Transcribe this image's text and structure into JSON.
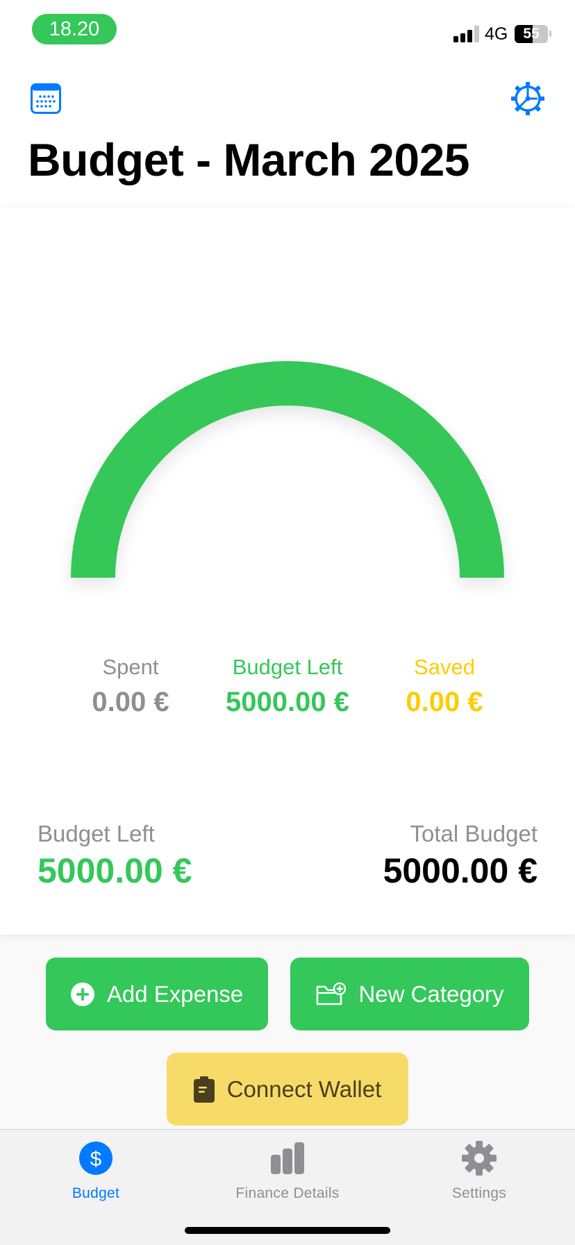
{
  "status_bar": {
    "time": "18.20",
    "network": "4G",
    "battery": "55",
    "battery_level": 0.55
  },
  "header": {
    "title": "Budget - March 2025",
    "calendar_icon": "calendar-icon",
    "settings_icon": "gear-icon"
  },
  "gauge": {
    "spent_fraction": 0.0,
    "color": "#34c759"
  },
  "stats": {
    "spent_label": "Spent",
    "spent_value": "0.00 €",
    "budget_left_label": "Budget Left",
    "budget_left_value": "5000.00 €",
    "saved_label": "Saved",
    "saved_value": "0.00 €"
  },
  "summary": {
    "left_label": "Budget Left",
    "left_value": "5000.00 €",
    "total_label": "Total Budget",
    "total_value": "5000.00 €"
  },
  "actions": {
    "add_expense": "Add Expense",
    "new_category": "New Category",
    "connect_wallet": "Connect Wallet"
  },
  "tabbar": {
    "tabs": [
      {
        "label": "Budget",
        "icon": "dollar-icon",
        "active": true
      },
      {
        "label": "Finance Details",
        "icon": "bar-chart-icon",
        "active": false
      },
      {
        "label": "Settings",
        "icon": "gear-icon",
        "active": false
      }
    ]
  },
  "colors": {
    "green": "#34c759",
    "yellow": "#ffcc00",
    "gray": "#8e8e93",
    "blue": "#007aff",
    "wallet_button": "#f7db69"
  }
}
